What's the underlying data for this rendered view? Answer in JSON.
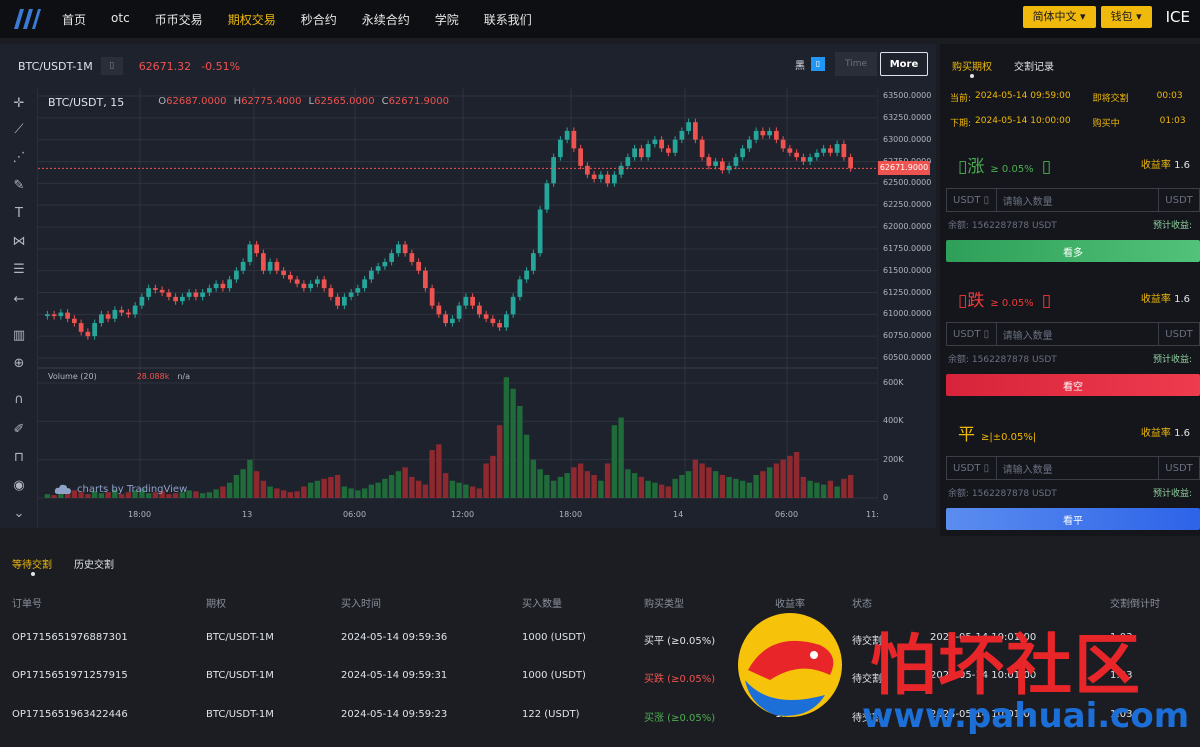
{
  "nav": {
    "items": [
      {
        "label": "首页",
        "active": false
      },
      {
        "label": "otc",
        "active": false
      },
      {
        "label": "币币交易",
        "active": false
      },
      {
        "label": "期权交易",
        "active": true
      },
      {
        "label": "秒合约",
        "active": false
      },
      {
        "label": "永续合约",
        "active": false
      },
      {
        "label": "学院",
        "active": false
      },
      {
        "label": "联系我们",
        "active": false
      }
    ],
    "language": "简体中文",
    "wallet": "钱包",
    "user_logo": "ICE"
  },
  "chart_header": {
    "pair": "BTC/USDT-1M",
    "pair_tag": "▯",
    "price": "62671.32",
    "change": "-0.51%",
    "theme_label": "黑",
    "theme_icon": "▯",
    "time_label": "Time",
    "more_label": "More"
  },
  "legend": {
    "symbol": "BTC/USDT, 15",
    "open_k": "O",
    "open": "62687.0000",
    "high_k": "H",
    "high": "62775.4000",
    "low_k": "L",
    "low": "62565.0000",
    "close_k": "C",
    "close": "62671.9000",
    "volume_title": "Volume (20)",
    "volume_value": "28.088k",
    "volume_na": "n/a",
    "brand": "charts by TradingView"
  },
  "side": {
    "tabs": [
      {
        "label": "购买期权",
        "active": true
      },
      {
        "label": "交割记录",
        "active": false
      }
    ],
    "current_label": "当前:",
    "current_time": "2024-05-14 09:59:00",
    "deliver_label": "即将交割",
    "deliver_count": "00:03",
    "next_label": "下期:",
    "next_time": "2024-05-14 10:00:00",
    "buying_label": "购买中",
    "buying_count": "01:03",
    "up": {
      "icon": "▯",
      "title": "涨",
      "threshold": "≥ 0.05%",
      "icon2": "▯",
      "rate_label": "收益率",
      "rate": "1.6",
      "unit_left": "USDT ▯",
      "placeholder": "请输入数量",
      "unit_right": "USDT",
      "balance": "余额: 1562287878 USDT",
      "est": "预计收益: ",
      "button": "看多"
    },
    "down": {
      "icon": "▯",
      "title": "跌",
      "threshold": "≥ 0.05%",
      "icon2": "▯",
      "rate_label": "收益率",
      "rate": "1.6",
      "unit_left": "USDT ▯",
      "placeholder": "请输入数量",
      "unit_right": "USDT",
      "balance": "余额: 1562287878 USDT",
      "est": "预计收益: ",
      "button": "看空"
    },
    "flat": {
      "title": "平",
      "threshold": "≥|±0.05%|",
      "rate_label": "收益率",
      "rate": "1.6",
      "unit_left": "USDT ▯",
      "placeholder": "请输入数量",
      "unit_right": "USDT",
      "balance": "余额: 1562287878 USDT",
      "est": "预计收益: ",
      "button": "看平"
    }
  },
  "orders": {
    "tabs": [
      {
        "label": "等待交割",
        "active": true
      },
      {
        "label": "历史交割",
        "active": false
      }
    ],
    "headers": [
      "订单号",
      "期权",
      "买入时间",
      "买入数量",
      "购买类型",
      "收益率",
      "状态",
      "交割倒计时"
    ],
    "rows": [
      {
        "id": "OP1715651976887301",
        "option": "BTC/USDT-1M",
        "time": "2024-05-14 09:59:36",
        "qty": "1000 (USDT)",
        "type": "买平 (≥0.05%)",
        "type_color": "normal",
        "rate": "1",
        "status": "待交割",
        "settle": "2024-05-14 10:01:00",
        "countdown": "1:03"
      },
      {
        "id": "OP1715651971257915",
        "option": "BTC/USDT-1M",
        "time": "2024-05-14 09:59:31",
        "qty": "1000 (USDT)",
        "type": "买跌 (≥0.05%)",
        "type_color": "red",
        "rate": "1.6",
        "status": "待交割",
        "settle": "2024-05-14 10:01:00",
        "countdown": "1:03"
      },
      {
        "id": "OP1715651963422446",
        "option": "BTC/USDT-1M",
        "time": "2024-05-14 09:59:23",
        "qty": "122 (USDT)",
        "type": "买涨 (≥0.05%)",
        "type_color": "green",
        "rate": "1.6",
        "status": "待交割",
        "settle": "2024-05-14 10:01:00",
        "countdown": "1:03"
      }
    ]
  },
  "watermark": {
    "title": "怕坏社区",
    "url": "www.pahuai.com"
  },
  "colors": {
    "up": "#26a69a",
    "down": "#ef5350",
    "accent": "#f0b90b",
    "chart_bg": "#1e222d"
  },
  "chart_data": {
    "type": "candlestick",
    "y_ticks": [
      "63500.0000",
      "63250.0000",
      "63000.0000",
      "62750.0000",
      "62500.0000",
      "62250.0000",
      "62000.0000",
      "61750.0000",
      "61500.0000",
      "61250.0000",
      "61000.0000",
      "60750.0000",
      "60500.0000"
    ],
    "y_range": [
      60500,
      63500
    ],
    "vol_ticks": [
      "600K",
      "400K",
      "200K",
      "0"
    ],
    "vol_range": [
      0,
      600000
    ],
    "x_ticks": [
      "18:00",
      "13",
      "06:00",
      "12:00",
      "18:00",
      "14",
      "06:00",
      "11:"
    ],
    "last_price_label": "62671.9000",
    "closes": [
      61000,
      60980,
      61020,
      60950,
      60900,
      60800,
      60750,
      60900,
      61000,
      60950,
      61050,
      61020,
      61000,
      61100,
      61200,
      61300,
      61280,
      61250,
      61200,
      61150,
      61200,
      61250,
      61200,
      61250,
      61300,
      61350,
      61300,
      61400,
      61500,
      61600,
      61800,
      61700,
      61500,
      61600,
      61500,
      61450,
      61400,
      61350,
      61300,
      61350,
      61400,
      61300,
      61200,
      61100,
      61200,
      61250,
      61300,
      61400,
      61500,
      61550,
      61600,
      61700,
      61800,
      61700,
      61600,
      61500,
      61300,
      61100,
      61000,
      60900,
      60950,
      61100,
      61200,
      61100,
      61000,
      60950,
      60900,
      60850,
      61000,
      61200,
      61400,
      61500,
      61700,
      62200,
      62500,
      62800,
      63000,
      63100,
      62900,
      62700,
      62600,
      62550,
      62600,
      62500,
      62600,
      62700,
      62800,
      62900,
      62800,
      62950,
      63000,
      62900,
      62850,
      63000,
      63100,
      63200,
      63000,
      62800,
      62700,
      62750,
      62650,
      62700,
      62800,
      62900,
      63000,
      63100,
      63050,
      63100,
      63000,
      62900,
      62850,
      62800,
      62750,
      62800,
      62850,
      62900,
      62850,
      62950,
      62800,
      62671.9
    ],
    "volumes": [
      20,
      15,
      30,
      25,
      40,
      30,
      20,
      35,
      25,
      30,
      45,
      20,
      30,
      40,
      50,
      25,
      30,
      35,
      20,
      25,
      30,
      40,
      35,
      25,
      30,
      45,
      60,
      80,
      120,
      150,
      200,
      140,
      90,
      60,
      50,
      40,
      30,
      35,
      60,
      80,
      90,
      100,
      110,
      120,
      60,
      50,
      40,
      50,
      70,
      80,
      100,
      120,
      140,
      160,
      110,
      90,
      70,
      250,
      280,
      130,
      90,
      80,
      70,
      60,
      50,
      180,
      220,
      380,
      640,
      570,
      480,
      330,
      200,
      150,
      120,
      90,
      110,
      130,
      160,
      180,
      140,
      120,
      90,
      180,
      380,
      420,
      150,
      130,
      110,
      90,
      80,
      70,
      60,
      100,
      120,
      140,
      200,
      180,
      160,
      140,
      120,
      110,
      100,
      90,
      80,
      120,
      140,
      160,
      180,
      200,
      220,
      240,
      110,
      90,
      80,
      70,
      90,
      60,
      100,
      120
    ]
  }
}
